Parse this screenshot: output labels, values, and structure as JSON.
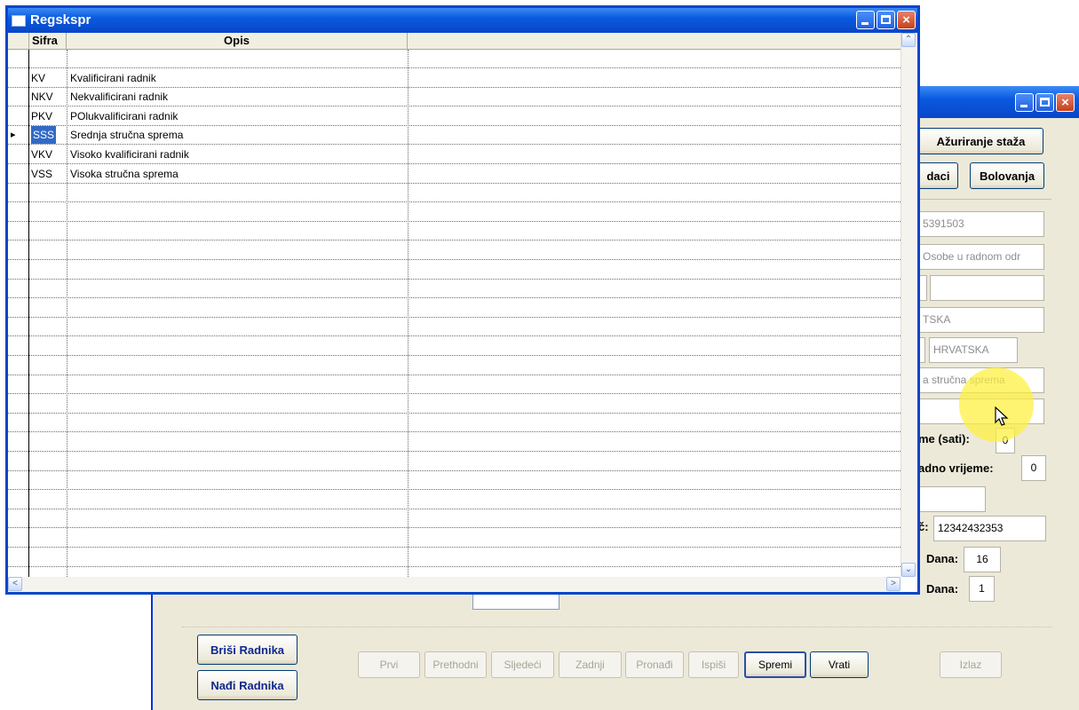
{
  "front_window": {
    "title": "Regskspr",
    "columns": [
      "Sifra",
      "Opis"
    ],
    "rows": [
      {
        "code": "",
        "desc": ""
      },
      {
        "code": "KV",
        "desc": "Kvalificirani radnik"
      },
      {
        "code": "NKV",
        "desc": "Nekvalificirani radnik"
      },
      {
        "code": "PKV",
        "desc": "POlukvalificirani radnik"
      },
      {
        "code": "SSS",
        "desc": "Srednja stručna sprema"
      },
      {
        "code": "VKV",
        "desc": "Visoko kvalificirani radnik"
      },
      {
        "code": "VSS",
        "desc": "Visoka stručna sprema"
      }
    ],
    "selected_row": "SSS",
    "scroll_up_glyph": "⌃",
    "scroll_down_glyph": "⌄",
    "scroll_left_glyph": "<",
    "scroll_right_glyph": ">"
  },
  "back_window": {
    "buttons": {
      "azuriranje_staza": "Ažuriranje staža",
      "podaci": "daci",
      "bolovanja": "Bolovanja",
      "brisi_radnika": "Briši Radnika",
      "nadi_radnika": "Nađi Radnika",
      "prvi": "Prvi",
      "prethodni": "Prethodni",
      "sljedeci": "Sljedeći",
      "zadnji": "Zadnji",
      "pronadi": "Pronađi",
      "ispisi": "Ispiši",
      "spremi": "Spremi",
      "vrati": "Vrati",
      "izlaz": "Izlaz"
    },
    "fields": {
      "oib": "5391503",
      "status": "Osobe u radnom odr",
      "drzava": "TSKA",
      "drzava2": "HRVATSKA",
      "sprema": "a stručna sprema",
      "racun": "12342432353",
      "dana1": "16",
      "dana2": "1",
      "sati": "0",
      "radno_vrijeme": "0"
    },
    "labels": {
      "sati": "me (sati):",
      "radno_vrijeme": "adno vrijeme:",
      "racun": "č:",
      "dana1": "Dana:",
      "dana2": "Dana:"
    }
  },
  "colors": {
    "title_blue": "#0a5ae0",
    "selection": "#316ac5",
    "highlight": "#fff03c"
  }
}
